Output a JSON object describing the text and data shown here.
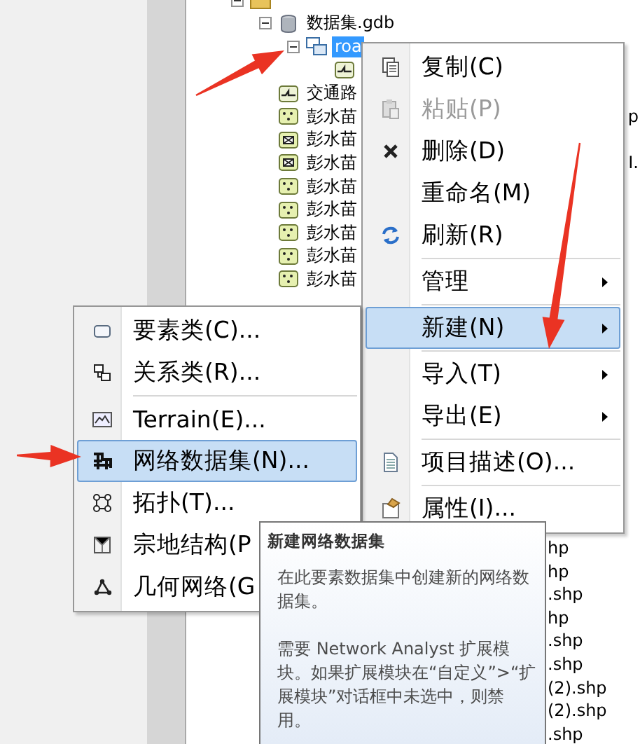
{
  "tree": {
    "items": [
      {
        "kind": "folder",
        "expanded": true,
        "children": [
          {
            "kind": "geodatabase",
            "label": "数据集.gdb",
            "expanded": true,
            "selected": false,
            "children": [
              {
                "kind": "feature_dataset",
                "label": "roa",
                "expanded": true,
                "selected": true,
                "children": [
                  {
                    "kind": "line"
                  }
                ]
              }
            ]
          },
          {
            "kind": "line",
            "label": "交通路",
            "selected": false
          },
          {
            "kind": "point",
            "label": "彭水苗",
            "tail": "p",
            "selected": false
          },
          {
            "kind": "polygon",
            "label": "彭水苗",
            "selected": false
          },
          {
            "kind": "polygon",
            "label": "彭水苗",
            "tail": "I.",
            "selected": false
          },
          {
            "kind": "point",
            "label": "彭水苗",
            "selected": false
          },
          {
            "kind": "point",
            "label": "彭水苗",
            "selected": false
          },
          {
            "kind": "point",
            "label": "彭水苗",
            "selected": false
          },
          {
            "kind": "point",
            "label": "彭水苗",
            "selected": false
          },
          {
            "kind": "point",
            "label": "彭水苗",
            "selected": false
          }
        ]
      }
    ],
    "clipped_rows": [
      {
        "text": "hp"
      },
      {
        "text": "hp"
      },
      {
        "text": ".shp"
      },
      {
        "text": "hp"
      },
      {
        "text": ".shp"
      },
      {
        "text": ".shp"
      },
      {
        "text": "(2).shp"
      },
      {
        "text": "(2).shp"
      },
      {
        "text": ".shp"
      }
    ]
  },
  "context_menu": {
    "items": [
      {
        "kind": "item",
        "label": "复制(C)",
        "disabled": false,
        "selected": false,
        "has_submenu": false
      },
      {
        "kind": "item",
        "label": "粘贴(P)",
        "disabled": true,
        "selected": false,
        "has_submenu": false
      },
      {
        "kind": "item",
        "label": "删除(D)",
        "disabled": false,
        "selected": false,
        "has_submenu": false
      },
      {
        "kind": "item",
        "label": "重命名(M)",
        "disabled": false,
        "selected": false,
        "has_submenu": false
      },
      {
        "kind": "item",
        "label": "刷新(R)",
        "disabled": false,
        "selected": false,
        "has_submenu": false
      },
      {
        "kind": "separator"
      },
      {
        "kind": "item",
        "label": "管理",
        "disabled": false,
        "selected": false,
        "has_submenu": true
      },
      {
        "kind": "separator"
      },
      {
        "kind": "item",
        "label": "新建(N)",
        "disabled": false,
        "selected": true,
        "has_submenu": true
      },
      {
        "kind": "separator"
      },
      {
        "kind": "item",
        "label": "导入(T)",
        "disabled": false,
        "selected": false,
        "has_submenu": true
      },
      {
        "kind": "item",
        "label": "导出(E)",
        "disabled": false,
        "selected": false,
        "has_submenu": true
      },
      {
        "kind": "separator"
      },
      {
        "kind": "item",
        "label": "项目描述(O)...",
        "disabled": false,
        "selected": false,
        "has_submenu": false
      },
      {
        "kind": "separator"
      },
      {
        "kind": "item",
        "label": "属性(I)...",
        "disabled": false,
        "selected": false,
        "has_submenu": false
      }
    ]
  },
  "submenu": {
    "items": [
      {
        "kind": "item",
        "label": "要素类(C)...",
        "disabled": false,
        "selected": false,
        "has_submenu": false
      },
      {
        "kind": "item",
        "label": "关系类(R)...",
        "disabled": false,
        "selected": false,
        "has_submenu": false
      },
      {
        "kind": "separator"
      },
      {
        "kind": "item",
        "label": "Terrain(E)...",
        "disabled": false,
        "selected": false,
        "has_submenu": false
      },
      {
        "kind": "item",
        "label": "网络数据集(N)...",
        "disabled": false,
        "selected": true,
        "has_submenu": false
      },
      {
        "kind": "item",
        "label": "拓扑(T)...",
        "disabled": false,
        "selected": false,
        "has_submenu": false
      },
      {
        "kind": "item",
        "label": "宗地结构(P",
        "disabled": false,
        "selected": false,
        "has_submenu": false
      },
      {
        "kind": "item",
        "label": "几何网络(G",
        "disabled": false,
        "selected": false,
        "has_submenu": false
      }
    ]
  },
  "tooltip": {
    "title": "新建网络数据集",
    "paragraphs": [
      "在此要素数据集中创建新的网络数据集。",
      "需要 Network Analyst 扩展模块。如果扩展模块在“自定义”>“扩展模块”对话框中未选中，则禁用。"
    ]
  }
}
